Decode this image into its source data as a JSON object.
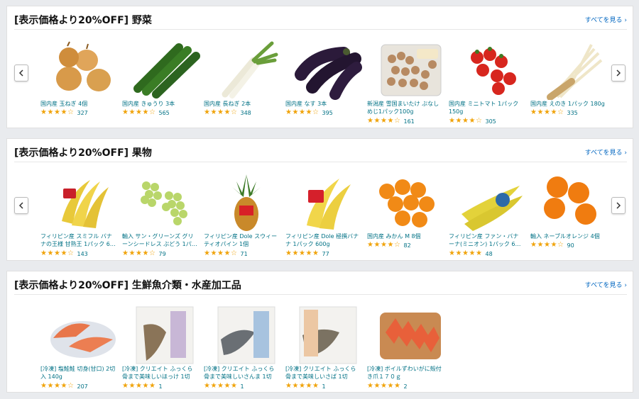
{
  "see_all_label": "すべてを見る ›",
  "sections": [
    {
      "title": "[表示価格より20%OFF] 野菜",
      "items": [
        {
          "name": "国内産 玉ねぎ 4個",
          "stars": 4,
          "count": "327",
          "icon": "onion-image"
        },
        {
          "name": "国内産 きゅうり 3本",
          "stars": 4,
          "count": "565",
          "icon": "cucumber-image"
        },
        {
          "name": "国内産 長ねぎ 2本",
          "stars": 4,
          "count": "348",
          "icon": "leek-image"
        },
        {
          "name": "国内産 なす 3本",
          "stars": 4,
          "count": "395",
          "icon": "eggplant-image"
        },
        {
          "name": "新潟産 雪国まいたけ ぶなしめじ1パック100g",
          "stars": 4,
          "count": "161",
          "icon": "shimeji-image"
        },
        {
          "name": "国内産 ミニトマト 1パック 150g",
          "stars": 4,
          "count": "305",
          "icon": "cherry-tomato-image"
        },
        {
          "name": "国内産 えのき 1パック 180g",
          "stars": 4,
          "count": "335",
          "icon": "enoki-image"
        }
      ]
    },
    {
      "title": "[表示価格より20%OFF] 果物",
      "items": [
        {
          "name": "フィリピン産 スミフル バナナの王様 甘熟王 1パック 6…",
          "stars": 4,
          "count": "143",
          "icon": "banana-image"
        },
        {
          "name": "輸入 サン・グリーンズ グリーンシードレス ぶどう 1パ…",
          "stars": 4,
          "count": "79",
          "icon": "grape-image"
        },
        {
          "name": "フィリピン産 Dole スウィーティオパイン 1個",
          "stars": 4,
          "count": "71",
          "icon": "pineapple-image"
        },
        {
          "name": "フィリピン産 Dole 極撰バナナ 1パック 600g",
          "stars": 4.5,
          "count": "77",
          "icon": "banana-pack-image"
        },
        {
          "name": "国内産 みかん M 8個",
          "stars": 4,
          "count": "82",
          "icon": "mikan-image"
        },
        {
          "name": "フィリピン産 ファン・バナーナ(ミニオン) 1パック 6…",
          "stars": 4.5,
          "count": "48",
          "icon": "minion-banana-image"
        },
        {
          "name": "輸入 ネーブルオレンジ 4個",
          "stars": 4,
          "count": "90",
          "icon": "orange-image"
        }
      ]
    },
    {
      "title": "[表示価格より20%OFF] 生鮮魚介類・水産加工品",
      "items": [
        {
          "name": "[冷凍] 塩鮭鮭 切身(甘口) 2切入 140g",
          "stars": 4,
          "count": "207",
          "icon": "salmon-image"
        },
        {
          "name": "[冷凍] クリエイト ふっくら骨まで美味しいほっけ 1切",
          "stars": 5,
          "count": "1",
          "icon": "hokke-pack-image"
        },
        {
          "name": "[冷凍] クリエイト ふっくら骨まで美味しいさんま 1切",
          "stars": 5,
          "count": "1",
          "icon": "sanma-pack-image"
        },
        {
          "name": "[冷凍] クリエイト ふっくら骨まで美味しいさば 1切",
          "stars": 5,
          "count": "1",
          "icon": "saba-pack-image"
        },
        {
          "name": "[冷凍] ボイルずわいがに殻付き爪１７０ｇ",
          "stars": 4.5,
          "count": "2",
          "icon": "crab-image"
        }
      ]
    }
  ]
}
